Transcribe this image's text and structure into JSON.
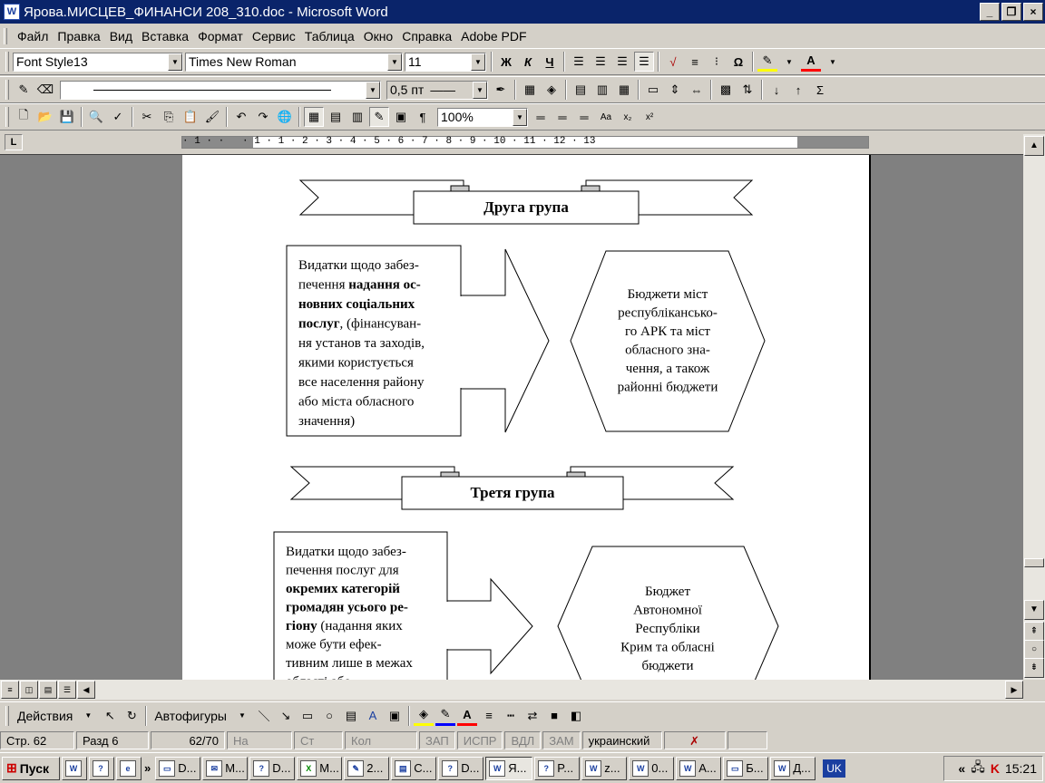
{
  "window": {
    "title": "Ярова.МИСЦЕВ_ФИНАНСИ 208_310.doc - Microsoft Word",
    "btn_min": "_",
    "btn_restore": "❐",
    "btn_close": "×"
  },
  "menu": [
    "Файл",
    "Правка",
    "Вид",
    "Вставка",
    "Формат",
    "Сервис",
    "Таблица",
    "Окно",
    "Справка",
    "Adobe PDF"
  ],
  "formatting": {
    "style": "Font Style13",
    "font": "Times New Roman",
    "size": "11",
    "bold": "Ж",
    "italic": "К",
    "underline": "Ч"
  },
  "drawing_toolbar": {
    "line_weight": "0,5 пт"
  },
  "standard": {
    "zoom": "100%"
  },
  "ruler": {
    "text": "· 1 · ·   · 1 · 1 · 2 · 3 · 4 · 5 · 6 · 7 · 8 · 9 · 10 · 11 · 12 · 13",
    "tab_selector": "L"
  },
  "document": {
    "group2": {
      "title": "Друга група",
      "left_lines": [
        "Видатки   щодо забез-",
        "печення надання ос-",
        "новних соціальних",
        "послуг, (фінансуван-",
        "ня установ та заходів,",
        "якими користується",
        "все населення району",
        "або міста обласного",
        "значення)"
      ],
      "right_lines": [
        "Бюджети міст",
        "республіканськ­о-",
        "го АРК та міст",
        "обласного зна-",
        "чення, а також",
        "районні бюджети"
      ]
    },
    "group3": {
      "title": "Третя група",
      "left_lines": [
        "Видатки щодо забез-",
        "печення послуг для",
        "окремих категорій",
        "громадян усього ре-",
        "гіону  (надання яких",
        "може бути ефек-",
        "тивним лише в межах",
        "області або"
      ],
      "right_lines": [
        "Бюджет",
        "Автономної",
        "Республіки",
        "Крим та обласні",
        "бюджети"
      ]
    }
  },
  "drawbar": {
    "actions": "Действия",
    "autoshapes": "Автофигуры"
  },
  "status": {
    "page": "Стр. 62",
    "section": "Разд 6",
    "pages": "62/70",
    "at": "На",
    "line": "Ст",
    "col": "Кол",
    "rec": "ЗАП",
    "trk": "ИСПР",
    "ext": "ВДЛ",
    "ovr": "ЗАМ",
    "lang": "украинский"
  },
  "taskbar": {
    "start": "Пуск",
    "buttons": [
      "D...",
      "M...",
      "D...",
      "M...",
      "2...",
      "C...",
      "D...",
      "Я...",
      "P...",
      "z...",
      "0...",
      "A...",
      "Б...",
      "Д..."
    ],
    "lang": "UK",
    "chevron": "«",
    "time": "15:21"
  }
}
